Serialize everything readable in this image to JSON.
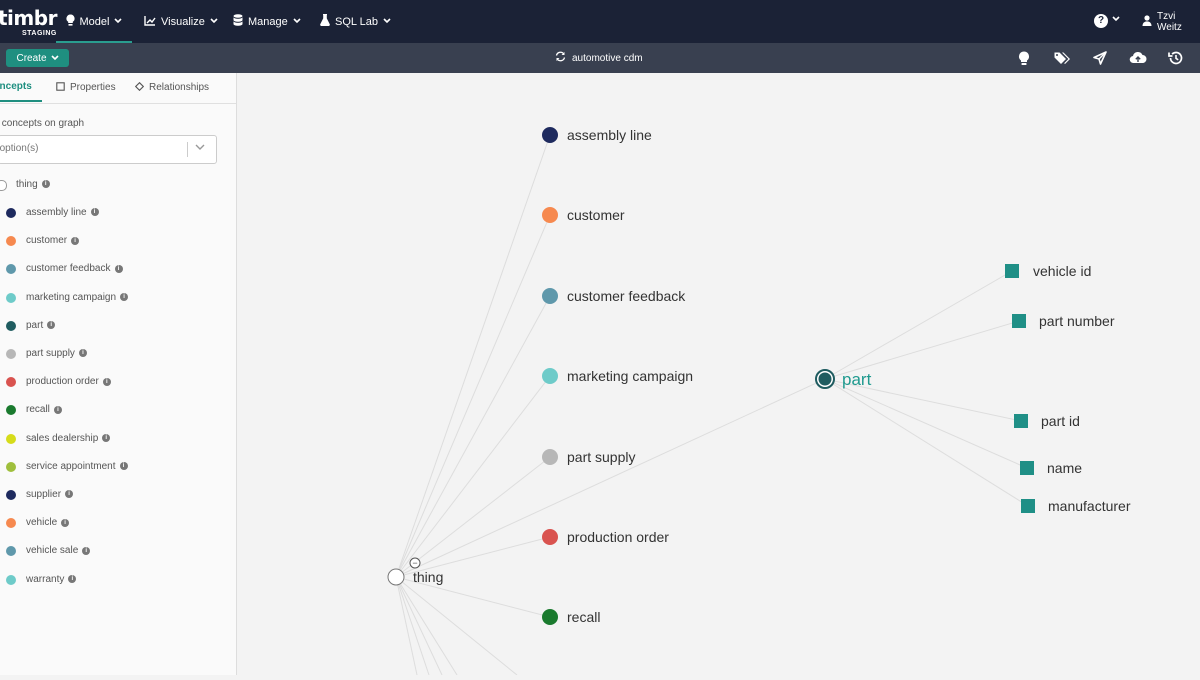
{
  "brand": {
    "name": "timbr",
    "env": "STAGING"
  },
  "nav": [
    {
      "label": "Model",
      "icon": "bulb-icon",
      "active": true
    },
    {
      "label": "Visualize",
      "icon": "chart-icon",
      "active": false
    },
    {
      "label": "Manage",
      "icon": "database-icon",
      "active": false
    },
    {
      "label": "SQL Lab",
      "icon": "flask-icon",
      "active": false
    }
  ],
  "help": {
    "label": "?"
  },
  "user": {
    "name": "Tzvi Weitz"
  },
  "toolbar": {
    "create_label": "Create",
    "model_name": "automotive cdm",
    "icons": [
      "lightbulb-icon",
      "tags-icon",
      "send-icon",
      "cloud-upload-icon",
      "history-icon"
    ]
  },
  "sidebar": {
    "tabs": [
      {
        "label": "Concepts",
        "active": true
      },
      {
        "label": "Properties",
        "active": false
      },
      {
        "label": "Relationships",
        "active": false
      }
    ],
    "filter_label": "Show concepts on graph",
    "filter_placeholder": "Select option(s)",
    "root": {
      "label": "thing"
    },
    "concepts": [
      {
        "label": "assembly line",
        "color": "#1e2a5e"
      },
      {
        "label": "customer",
        "color": "#f6894f"
      },
      {
        "label": "customer feedback",
        "color": "#5f98ab"
      },
      {
        "label": "marketing campaign",
        "color": "#6ecbc9"
      },
      {
        "label": "part",
        "color": "#1f5c60"
      },
      {
        "label": "part supply",
        "color": "#b7b7b7"
      },
      {
        "label": "production order",
        "color": "#d9534f"
      },
      {
        "label": "recall",
        "color": "#1a7a2e"
      },
      {
        "label": "sales dealership",
        "color": "#d6dc1a"
      },
      {
        "label": "service appointment",
        "color": "#9fbf3c"
      },
      {
        "label": "supplier",
        "color": "#1e2a5e"
      },
      {
        "label": "vehicle",
        "color": "#f6894f"
      },
      {
        "label": "vehicle sale",
        "color": "#5f98ab"
      },
      {
        "label": "warranty",
        "color": "#6ecbc9"
      }
    ]
  },
  "graph": {
    "root_label": "thing",
    "collapse_label": "−",
    "nodes": [
      {
        "label": "assembly line",
        "color": "#1e2a5e"
      },
      {
        "label": "customer",
        "color": "#f6894f"
      },
      {
        "label": "customer feedback",
        "color": "#5f98ab"
      },
      {
        "label": "marketing campaign",
        "color": "#6ecbc9"
      },
      {
        "label": "part supply",
        "color": "#b7b7b7"
      },
      {
        "label": "production order",
        "color": "#d9534f"
      },
      {
        "label": "recall",
        "color": "#1a7a2e"
      }
    ],
    "selected": {
      "label": "part",
      "color": "#1f5c60",
      "label_color": "#1f9a8f"
    },
    "properties": [
      {
        "label": "vehicle id"
      },
      {
        "label": "part number"
      },
      {
        "label": "part id"
      },
      {
        "label": "name"
      },
      {
        "label": "manufacturer"
      }
    ],
    "property_color": "#1f8f86"
  }
}
